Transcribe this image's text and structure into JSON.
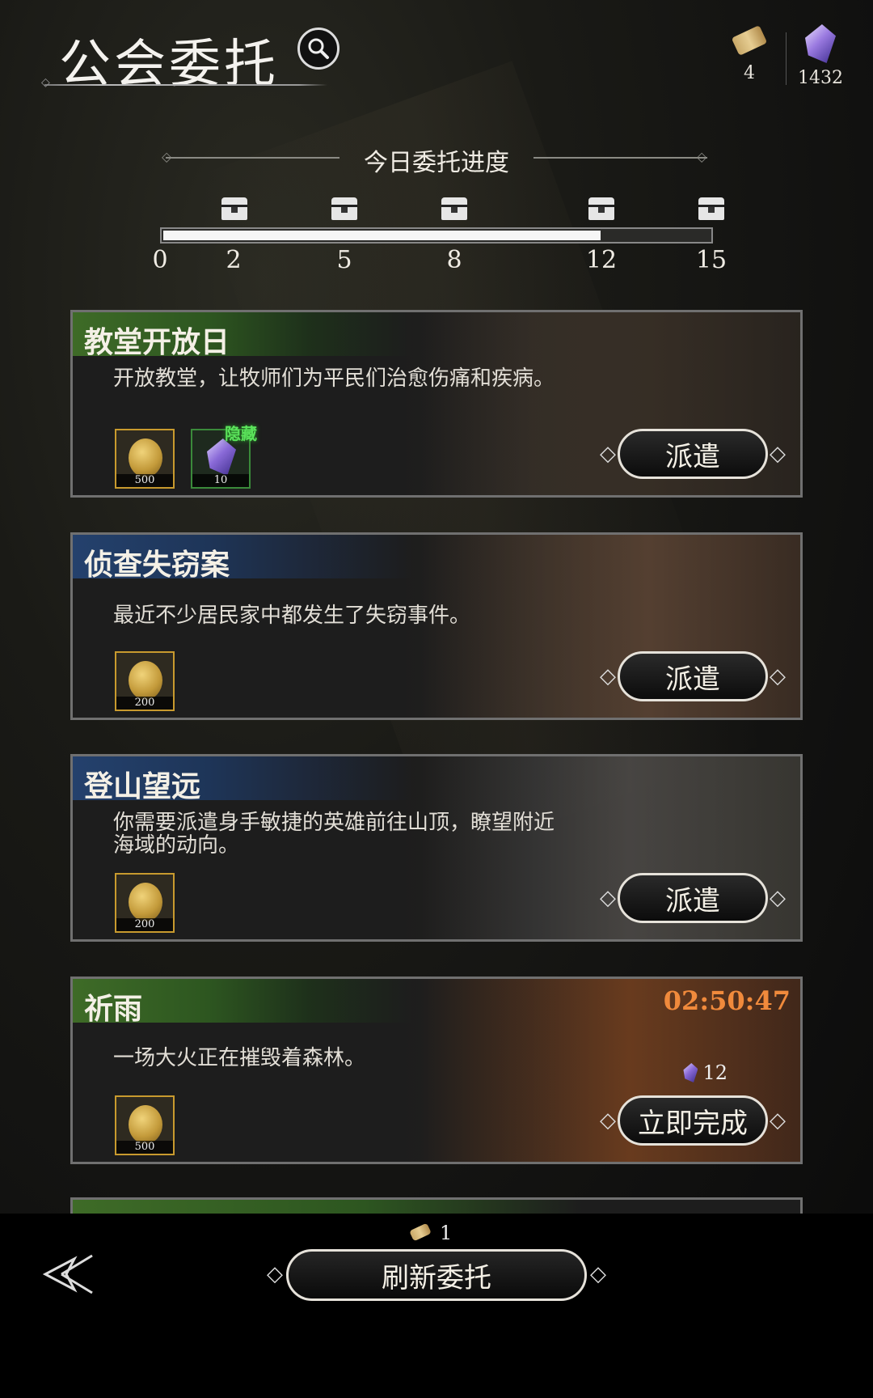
{
  "header": {
    "title": "公会委托",
    "currencies": [
      {
        "icon": "scroll-icon",
        "value": "4"
      },
      {
        "icon": "crystal-icon",
        "value": "1432"
      }
    ]
  },
  "progress": {
    "title": "今日委托进度",
    "current": 12,
    "max": 15,
    "ticks": [
      "0",
      "2",
      "5",
      "8",
      "12",
      "15"
    ]
  },
  "commissions": [
    {
      "title": "教堂开放日",
      "theme": "green",
      "description": "开放教堂，让牧师们为平民们治愈伤痛和疾病。",
      "rewards": [
        {
          "icon": "gold-coin-icon",
          "qty": "500"
        },
        {
          "icon": "crystal-icon",
          "qty": "10",
          "tag": "隐藏"
        }
      ],
      "button": "派遣"
    },
    {
      "title": "侦查失窃案",
      "theme": "blue",
      "description": "最近不少居民家中都发生了失窃事件。",
      "rewards": [
        {
          "icon": "gold-coin-icon",
          "qty": "200"
        }
      ],
      "button": "派遣"
    },
    {
      "title": "登山望远",
      "theme": "blue",
      "description": "你需要派遣身手敏捷的英雄前往山顶，瞭望附近海域的动向。",
      "rewards": [
        {
          "icon": "gold-coin-icon",
          "qty": "200"
        }
      ],
      "button": "派遣"
    },
    {
      "title": "祈雨",
      "theme": "green",
      "description": "一场大火正在摧毁着森林。",
      "rewards": [
        {
          "icon": "gold-coin-icon",
          "qty": "500"
        }
      ],
      "timer": "02:50:47",
      "cost": "12",
      "button": "立即完成"
    }
  ],
  "footer": {
    "refresh_cost": "1",
    "refresh_label": "刷新委托"
  }
}
